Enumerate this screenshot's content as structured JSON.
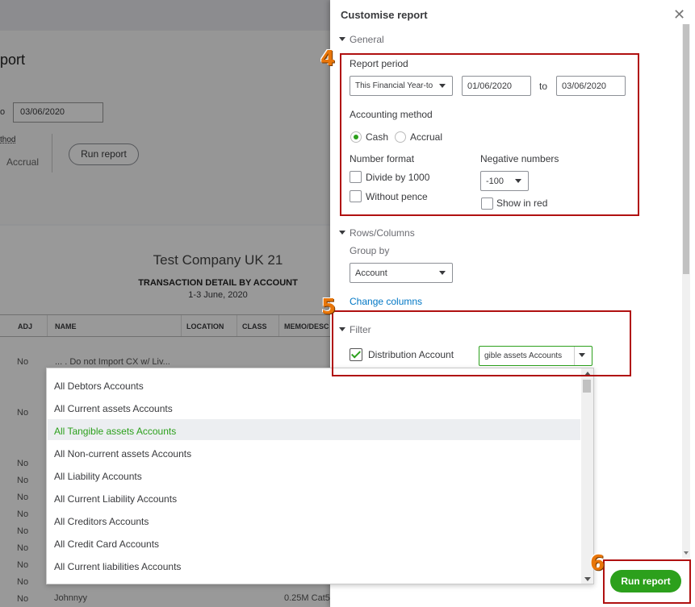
{
  "background_report": {
    "title_fragment": "port",
    "to_fragment": "o",
    "end_date": "03/06/2020",
    "method_fragment": "thod",
    "accrual": "Accrual",
    "run_report": "Run report",
    "company": "Test Company UK 21",
    "report_title": "TRANSACTION DETAIL BY ACCOUNT",
    "report_dates": "1-3 June, 2020",
    "columns": [
      "ADJ",
      "NAME",
      "LOCATION",
      "CLASS",
      "MEMO/DESC"
    ],
    "row_values": {
      "first_adj": "No",
      "first_name": "... . Do not Import CX w/ Liv...",
      "second_adj": "No",
      "adj_no": "No",
      "last_name": "Johnnyy",
      "last_memo": "0.25M Cat5"
    }
  },
  "panel": {
    "title": "Customise report",
    "sections": {
      "general": "General",
      "rows_columns": "Rows/Columns",
      "filter": "Filter"
    },
    "report_period_label": "Report period",
    "report_period_value": "This Financial Year-to",
    "from_date": "01/06/2020",
    "to_label": "to",
    "to_date": "03/06/2020",
    "accounting_method_label": "Accounting method",
    "cash_label": "Cash",
    "accrual_label": "Accrual",
    "number_format_label": "Number format",
    "divide_label": "Divide by 1000",
    "without_pence_label": "Without pence",
    "negative_numbers_label": "Negative numbers",
    "negative_value": "-100",
    "show_in_red_label": "Show in red",
    "group_by_label": "Group by",
    "group_by_value": "Account",
    "change_columns": "Change columns",
    "distribution_account_label": "Distribution Account",
    "distribution_value": "gible assets Accounts",
    "run_report": "Run report"
  },
  "dropdown": {
    "items": [
      "All Debtors Accounts",
      "All Current assets Accounts",
      "All Tangible assets Accounts",
      "All Non-current assets Accounts",
      "All Liability Accounts",
      "All Current Liability Accounts",
      "All Creditors Accounts",
      "All Credit Card Accounts",
      "All Current liabilities Accounts"
    ],
    "selected_index": 2
  },
  "annotations": {
    "step4": "4",
    "step5": "5",
    "step6": "6"
  },
  "colors": {
    "accent_green": "#2ca01c",
    "link_blue": "#0077c5",
    "annotation_red": "#b01010",
    "annotation_orange": "#e8760a"
  }
}
